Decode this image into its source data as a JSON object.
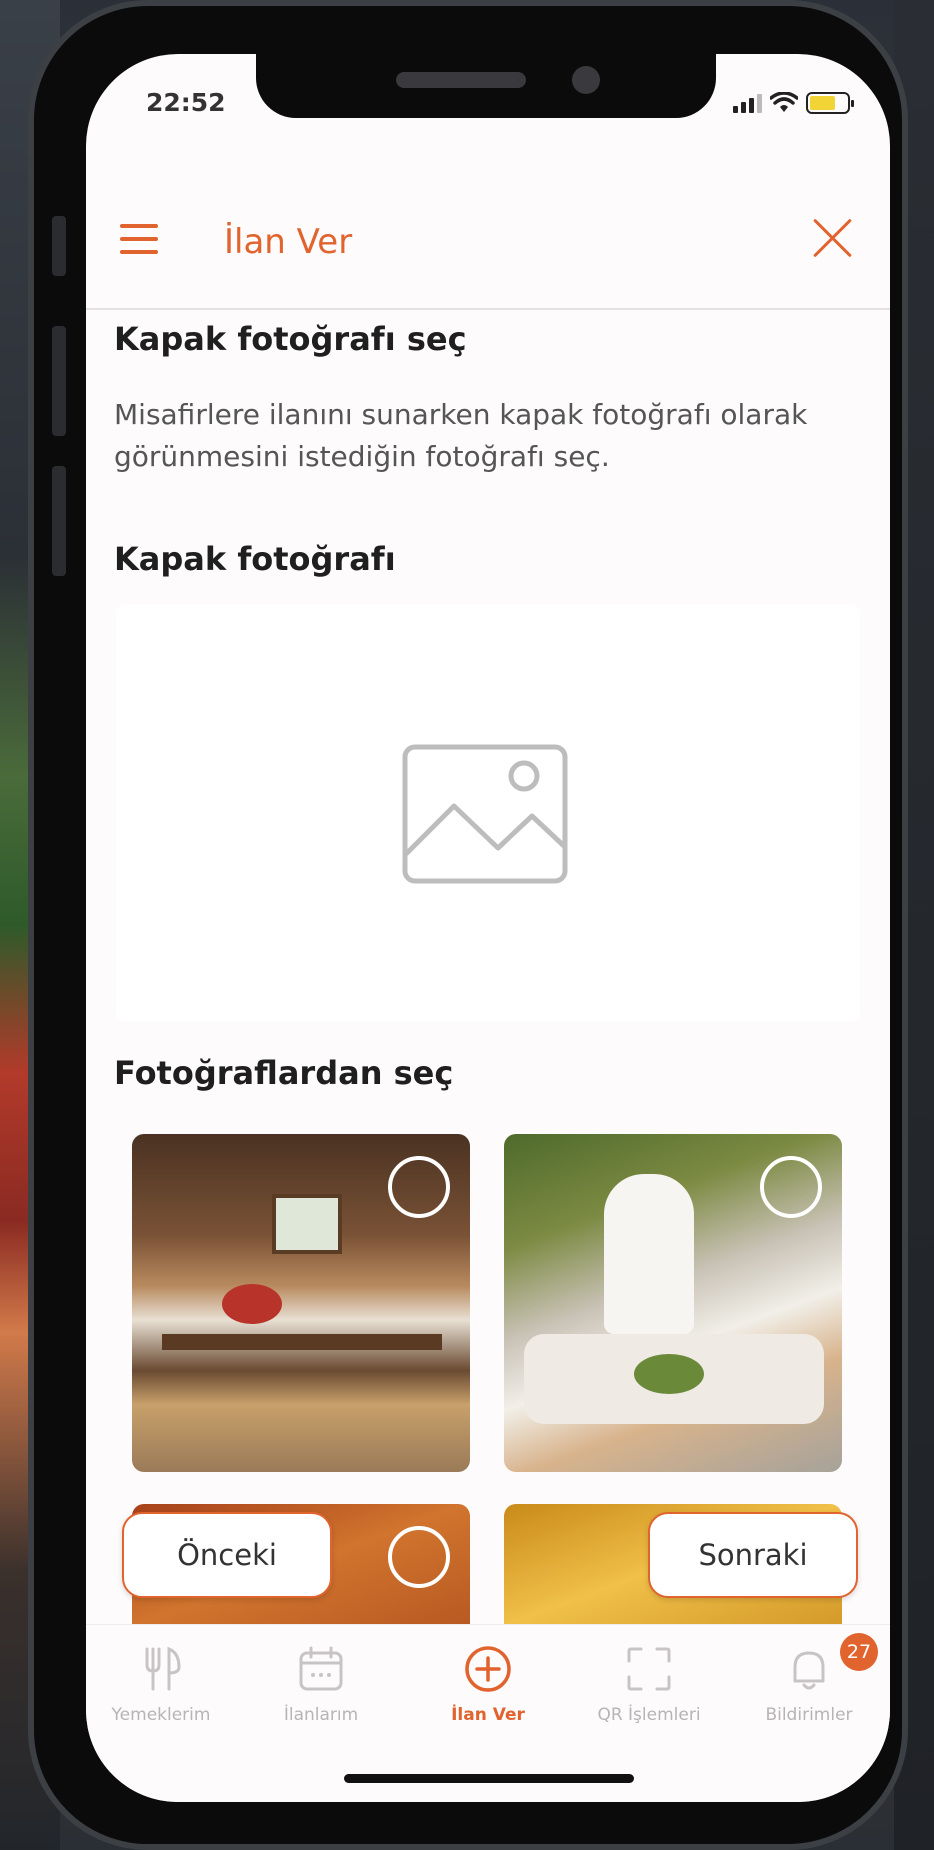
{
  "status_bar": {
    "time": "22:52"
  },
  "header": {
    "title": "İlan Ver"
  },
  "section_select_cover": {
    "title": "Kapak fotoğrafı seç",
    "description": "Misafirlere ilanını sunarken kapak fotoğrafı olarak görünmesini istediğin fotoğrafı seç."
  },
  "cover": {
    "title": "Kapak fotoğrafı"
  },
  "gallery": {
    "title": "Fotoğraflardan seç"
  },
  "buttons": {
    "previous": "Önceki",
    "next": "Sonraki"
  },
  "tabs": [
    {
      "label": "Yemeklerim",
      "icon": "utensils-icon"
    },
    {
      "label": "İlanlarım",
      "icon": "calendar-icon"
    },
    {
      "label": "İlan Ver",
      "icon": "plus-circle-icon"
    },
    {
      "label": "QR İşlemleri",
      "icon": "qr-scan-icon"
    },
    {
      "label": "Bildirimler",
      "icon": "bell-icon",
      "badge": "27"
    }
  ],
  "colors": {
    "accent": "#e1632e",
    "text": "#1f1f1f",
    "muted": "#b8b4b6"
  }
}
